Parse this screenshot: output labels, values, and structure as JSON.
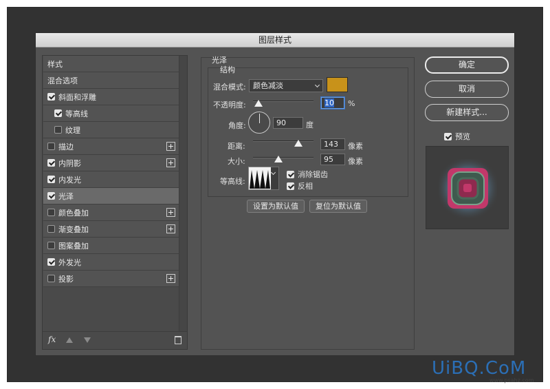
{
  "dialog": {
    "title": "图层样式"
  },
  "styles_panel": {
    "header": "样式",
    "items": [
      {
        "label": "混合选项",
        "checkbox": false,
        "checked": false,
        "plus": false,
        "indent": false,
        "selected": false
      },
      {
        "label": "斜面和浮雕",
        "checkbox": true,
        "checked": true,
        "plus": false,
        "indent": false,
        "selected": false
      },
      {
        "label": "等高线",
        "checkbox": true,
        "checked": true,
        "plus": false,
        "indent": true,
        "selected": false
      },
      {
        "label": "纹理",
        "checkbox": true,
        "checked": false,
        "plus": false,
        "indent": true,
        "selected": false
      },
      {
        "label": "描边",
        "checkbox": true,
        "checked": false,
        "plus": true,
        "indent": false,
        "selected": false
      },
      {
        "label": "内阴影",
        "checkbox": true,
        "checked": true,
        "plus": true,
        "indent": false,
        "selected": false
      },
      {
        "label": "内发光",
        "checkbox": true,
        "checked": true,
        "plus": false,
        "indent": false,
        "selected": false
      },
      {
        "label": "光泽",
        "checkbox": true,
        "checked": true,
        "plus": false,
        "indent": false,
        "selected": true
      },
      {
        "label": "颜色叠加",
        "checkbox": true,
        "checked": false,
        "plus": true,
        "indent": false,
        "selected": false
      },
      {
        "label": "渐变叠加",
        "checkbox": true,
        "checked": false,
        "plus": true,
        "indent": false,
        "selected": false
      },
      {
        "label": "图案叠加",
        "checkbox": true,
        "checked": false,
        "plus": false,
        "indent": false,
        "selected": false
      },
      {
        "label": "外发光",
        "checkbox": true,
        "checked": true,
        "plus": false,
        "indent": false,
        "selected": false
      },
      {
        "label": "投影",
        "checkbox": true,
        "checked": false,
        "plus": true,
        "indent": false,
        "selected": false
      }
    ],
    "footer_fx": "fx"
  },
  "satin": {
    "section_title": "光泽",
    "group_title": "结构",
    "blend_mode_label": "混合模式:",
    "blend_mode_value": "颜色减淡",
    "color": "#c8921a",
    "opacity_label": "不透明度:",
    "opacity_value": "10",
    "opacity_unit": "%",
    "angle_label": "角度:",
    "angle_value": "90",
    "angle_unit": "度",
    "distance_label": "距离:",
    "distance_value": "143",
    "distance_unit": "像素",
    "size_label": "大小:",
    "size_value": "95",
    "size_unit": "像素",
    "contour_label": "等高线:",
    "anti_alias_label": "消除锯齿",
    "anti_alias_checked": true,
    "invert_label": "反相",
    "invert_checked": true,
    "set_default_label": "设置为默认值",
    "reset_default_label": "复位为默认值"
  },
  "actions": {
    "ok_label": "确定",
    "cancel_label": "取消",
    "new_style_label": "新建样式...",
    "preview_label": "预览",
    "preview_checked": true
  },
  "watermark": {
    "text": "UiBQ.CoM",
    "sub": "www.psahz.com"
  }
}
